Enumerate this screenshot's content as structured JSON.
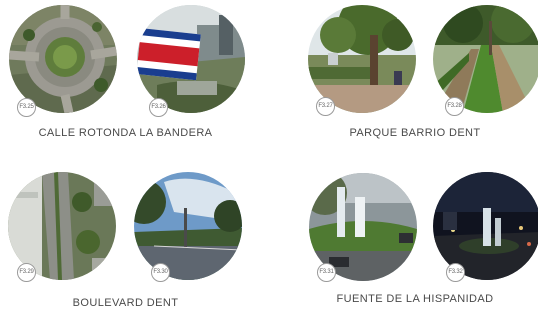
{
  "groups": [
    {
      "caption": "CALLE ROTONDA LA BANDERA",
      "photos": [
        {
          "label": "F3.25",
          "subject": "aerial view of roundabout"
        },
        {
          "label": "F3.26",
          "subject": "Costa Rica flag over city"
        }
      ]
    },
    {
      "caption": "PARQUE BARRIO DENT",
      "photos": [
        {
          "label": "F3.27",
          "subject": "park with large tree"
        },
        {
          "label": "F3.28",
          "subject": "park path with hedges"
        }
      ]
    },
    {
      "caption": "BOULEVARD DENT",
      "photos": [
        {
          "label": "F3.29",
          "subject": "aerial view of boulevard"
        },
        {
          "label": "F3.30",
          "subject": "tree-lined avenue under sky"
        }
      ]
    },
    {
      "caption": "FUENTE DE LA HISPANIDAD",
      "photos": [
        {
          "label": "F3.31",
          "subject": "fountain at roundabout, day"
        },
        {
          "label": "F3.32",
          "subject": "fountain at night"
        }
      ]
    }
  ]
}
